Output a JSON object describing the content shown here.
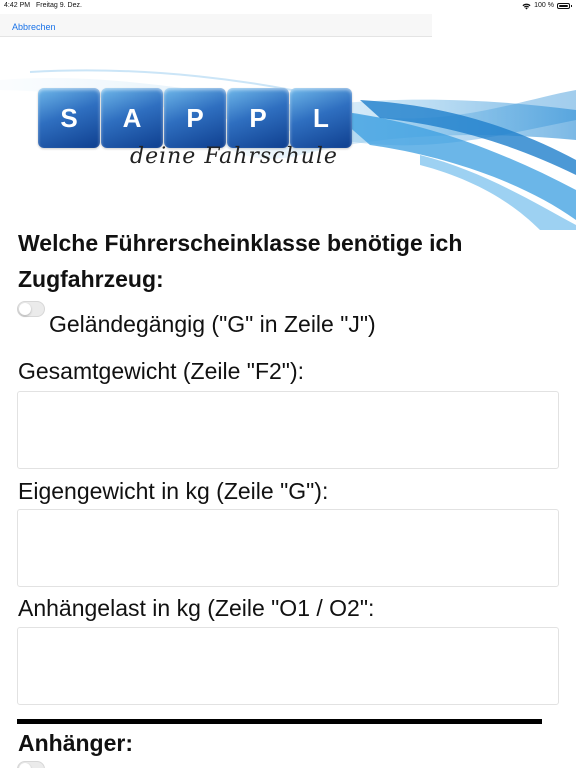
{
  "status_bar": {
    "time": "4:42 PM",
    "date": "Freitag 9. Dez.",
    "battery": "100 %"
  },
  "nav": {
    "cancel_label": "Abbrechen"
  },
  "logo": {
    "letters": [
      "S",
      "A",
      "P",
      "P",
      "L"
    ],
    "tagline": "deine Fahrschule"
  },
  "form": {
    "heading_towing": "Welche Führerscheinklasse benötige ich Zugfahrzeug:",
    "offroad_toggle_label": "Geländegängig (\"G\" in Zeile \"J\")",
    "offroad_enabled": false,
    "total_weight_label": "Gesamtgewicht (Zeile \"F2\"):",
    "total_weight_value": "",
    "empty_weight_label": "Eigengewicht in kg (Zeile \"G\"):",
    "empty_weight_value": "",
    "towing_load_label": "Anhängelast in kg (Zeile \"O1 / O2\":",
    "towing_load_value": "",
    "heading_trailer": "Anhänger:",
    "trailer_toggle_enabled": false
  },
  "colors": {
    "accent": "#1a73e8",
    "logo_blue": "#2f6fc0"
  }
}
